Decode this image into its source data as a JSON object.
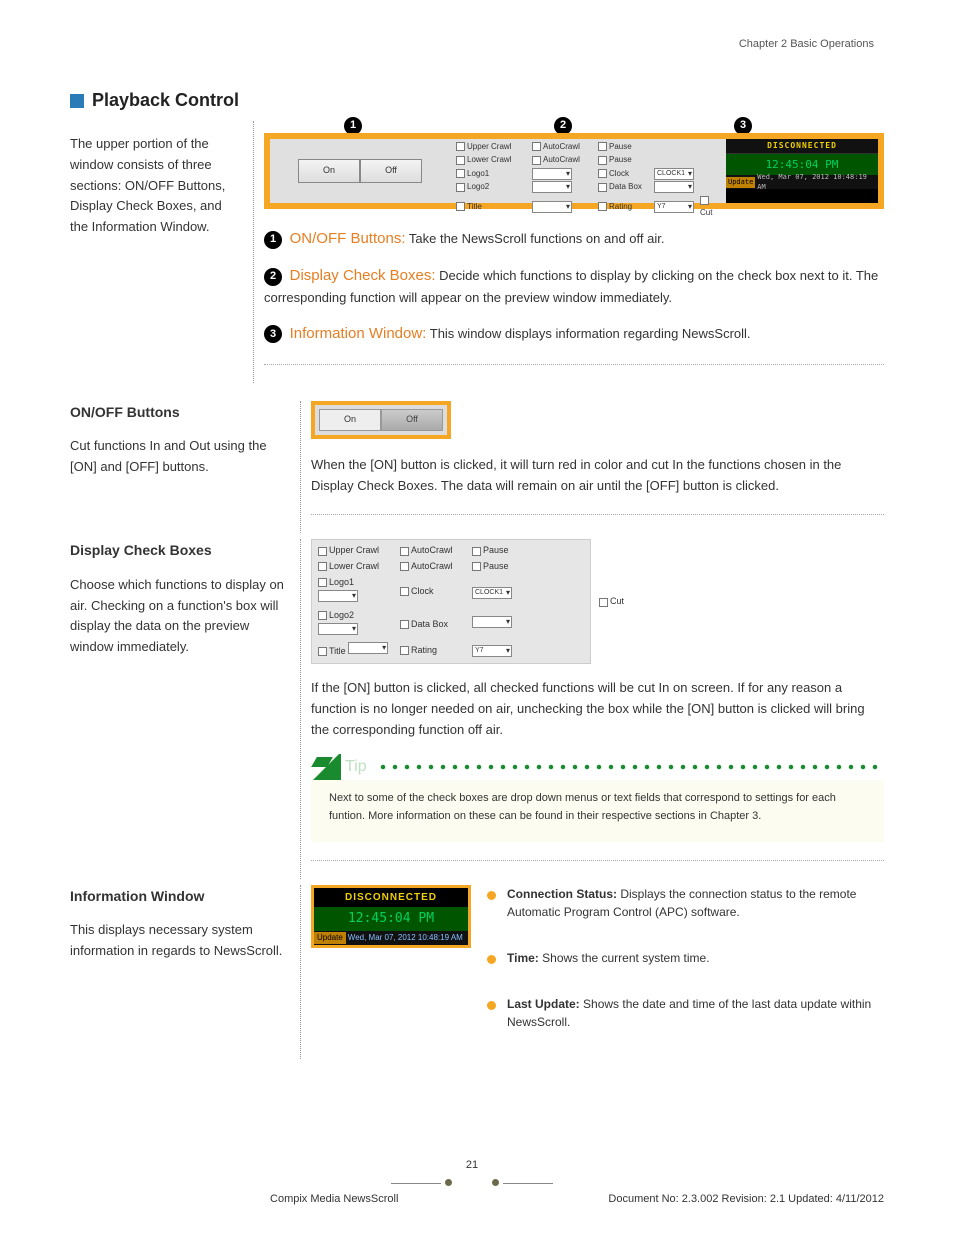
{
  "header": {
    "chapter": "Chapter 2 Basic Operations"
  },
  "h1": "Playback Control",
  "intro": "The upper portion of the window consists of three sections: ON/OFF Buttons, Display Check Boxes, and the Information Window.",
  "ui": {
    "on_label": "On",
    "off_label": "Off",
    "dcb": {
      "upper_crawl": "Upper Crawl",
      "lower_crawl": "Lower Crawl",
      "autocrawl": "AutoCrawl",
      "pause": "Pause",
      "logo1": "Logo1",
      "logo2": "Logo2",
      "title": "Title",
      "clock": "Clock",
      "data_box": "Data Box",
      "rating": "Rating",
      "clock1": "CLOCK1",
      "y7": "Y7",
      "cut": "Cut"
    },
    "info": {
      "status": "DISCONNECTED",
      "time": "12:45:04   PM",
      "update_label": "Update",
      "update_value": "Wed,  Mar 07,  2012   10:48:19 AM"
    }
  },
  "item1": {
    "num": "1",
    "title": "ON/OFF Buttons:",
    "text": "Take the NewsScroll functions on and off air."
  },
  "item2": {
    "num": "2",
    "title": "Display Check Boxes:",
    "text": "Decide which functions to display by clicking on the check box next to it. The corresponding function will appear on the preview window immediately."
  },
  "item3": {
    "num": "3",
    "title": "Information Window:",
    "text": "This window displays information regarding NewsScroll."
  },
  "sec1": {
    "title": "ON/OFF Buttons",
    "left": "Cut functions In and Out using the [ON] and [OFF] buttons.",
    "fig_on": "On",
    "fig_off": "Off",
    "right": "When the [ON] button is clicked, it will turn red in color and cut In the functions chosen in the Display Check Boxes. The data will remain on air until the [OFF] button is clicked."
  },
  "sec2": {
    "title": "Display Check Boxes",
    "left": "Choose which functions to display on air. Checking on a function's box will display the data on the preview window immediately.",
    "right": "If the [ON] button is clicked, all checked functions will be cut In on screen. If for any reason a function is no longer needed on air, unchecking the box while the [ON] button is clicked will bring the corresponding function off air."
  },
  "tip": {
    "label": "Tip",
    "text": "Next to some of the check boxes are drop down menus or text fields that correspond to settings for each funtion. More information on these can be found in their respective sections in Chapter 3."
  },
  "sec3": {
    "title": "Information Window",
    "left": "This displays necessary system information in regards to NewsScroll.",
    "conn_label": "Connection Status:",
    "conn_text": "Displays the connection status to the remote Automatic Program Control (APC) software.",
    "time_label": "Time:",
    "time_text": "Shows the current system time.",
    "upd_label": "Last Update:",
    "upd_text": "Shows the date and time of the last data update within NewsScroll."
  },
  "footer": {
    "page": "21",
    "product": "Compix Media NewsScroll",
    "docinfo": "Document No: 2.3.002 Revision: 2.1 Updated: 4/11/2012"
  }
}
